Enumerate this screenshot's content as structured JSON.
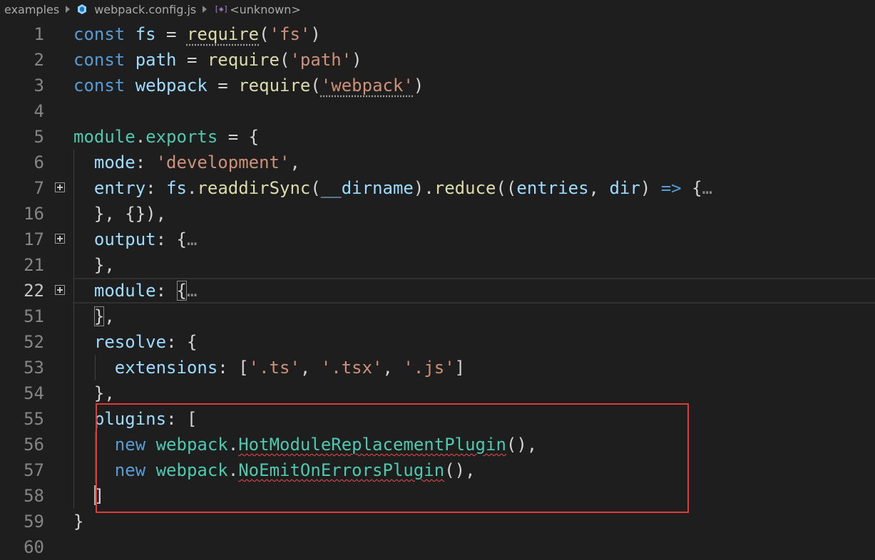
{
  "breadcrumb": {
    "folder": "examples",
    "file": "webpack.config.js",
    "symbol": "<unknown>"
  },
  "icons": {
    "file_icon": "webpack-js-icon",
    "symbol_icon": "symbol-variable-icon",
    "fold_icon": "plus-square-icon"
  },
  "colors": {
    "keyword": "#569cd6",
    "variable": "#9cdcfe",
    "string": "#ce9178",
    "function": "#dcdcaa",
    "type": "#4ec9b0",
    "highlight_box": "#e03a3a",
    "error_squiggle": "#f14c4c"
  },
  "lines": [
    {
      "n": "1",
      "text": "const fs = require('fs')"
    },
    {
      "n": "2",
      "text": "const path = require('path')"
    },
    {
      "n": "3",
      "text": "const webpack = require('webpack')"
    },
    {
      "n": "4",
      "text": ""
    },
    {
      "n": "5",
      "text": "module.exports = {"
    },
    {
      "n": "6",
      "text": "  mode: 'development',"
    },
    {
      "n": "7",
      "text": "  entry: fs.readdirSync(__dirname).reduce((entries, dir) => {…"
    },
    {
      "n": "16",
      "text": "  }, {}),"
    },
    {
      "n": "17",
      "text": "  output: {…"
    },
    {
      "n": "21",
      "text": "  },"
    },
    {
      "n": "22",
      "text": "  module: {…"
    },
    {
      "n": "51",
      "text": "  },"
    },
    {
      "n": "52",
      "text": "  resolve: {"
    },
    {
      "n": "53",
      "text": "    extensions: ['.ts', '.tsx', '.js']"
    },
    {
      "n": "54",
      "text": "  },"
    },
    {
      "n": "55",
      "text": "  plugins: ["
    },
    {
      "n": "56",
      "text": "    new webpack.HotModuleReplacementPlugin(),"
    },
    {
      "n": "57",
      "text": "    new webpack.NoEmitOnErrorsPlugin(),"
    },
    {
      "n": "58",
      "text": "  ]"
    },
    {
      "n": "59",
      "text": "}"
    },
    {
      "n": "60",
      "text": ""
    }
  ],
  "current_line": "22",
  "folded_lines": [
    "7",
    "17",
    "22"
  ],
  "highlighted_range": [
    "55",
    "58"
  ]
}
